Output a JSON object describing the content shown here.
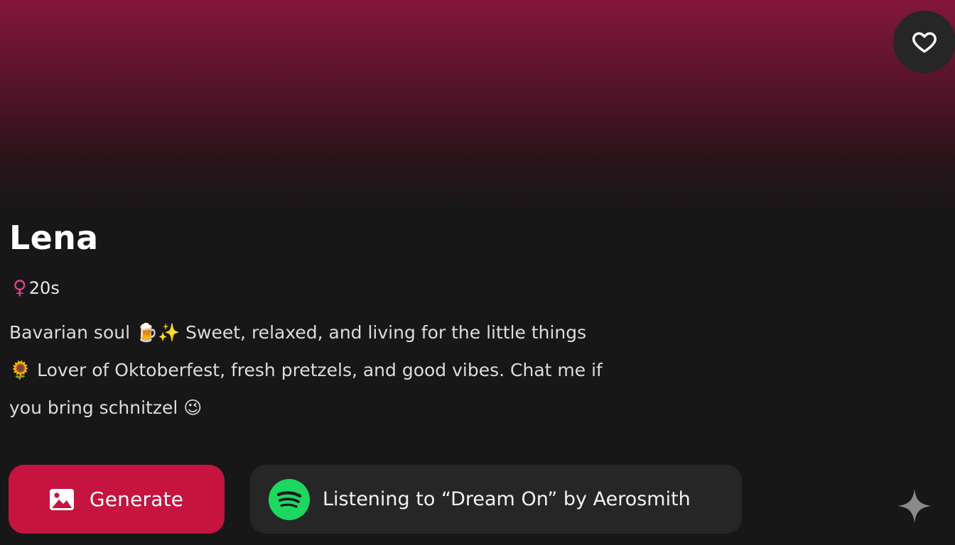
{
  "profile": {
    "name": "Lena",
    "gender_symbol": "♀",
    "age": "20s",
    "bio": "Bavarian soul 🍺✨ Sweet, relaxed, and living for the little things 🌻 Lover of Oktoberfest, fresh pretzels, and good vibes. Chat me if you bring schnitzel 😉"
  },
  "actions": {
    "generate_label": "Generate",
    "generate_icon": "image-icon",
    "favorite_icon": "heart-icon",
    "sparkle_icon": "sparkle-icon"
  },
  "spotify": {
    "icon": "spotify-icon",
    "listening_text": "Listening to “Dream On” by Aerosmith"
  },
  "colors": {
    "accent": "#c4143f",
    "gender_pink": "#e2458b",
    "spotify_green": "#1ed760",
    "background": "#171717",
    "card": "#262626",
    "hero_top": "#84163a"
  }
}
